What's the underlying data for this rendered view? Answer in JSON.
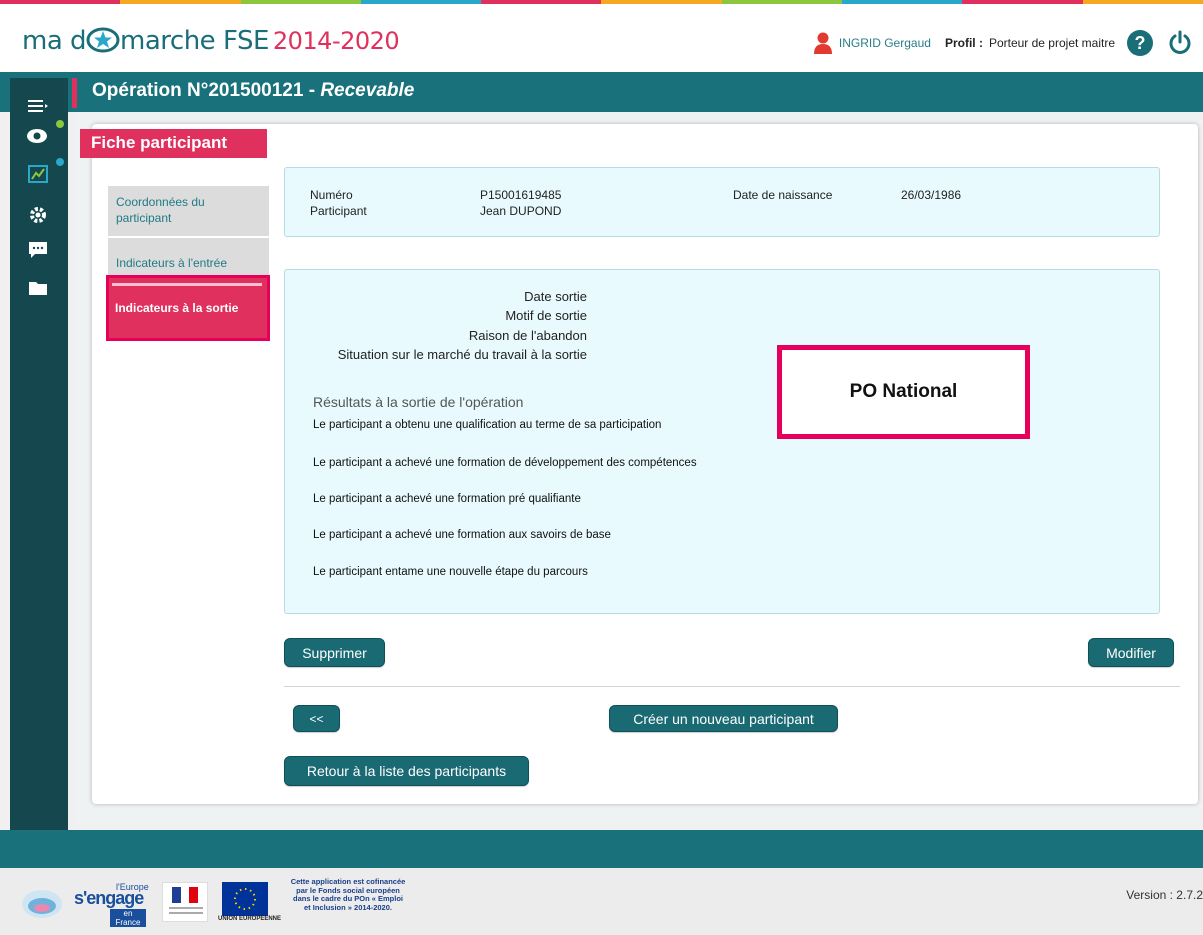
{
  "header": {
    "logo_prefix": "ma d",
    "logo_suffix": "marche FSE",
    "logo_years": "2014-2020",
    "user_name": "INGRID Gergaud",
    "profil_label": "Profil :",
    "profil_value": "Porteur de projet maitre"
  },
  "titlebar": {
    "operation": "Opération N°201500121 - ",
    "status": "Recevable"
  },
  "sidebar": {
    "icons": [
      "menu-icon",
      "eye-icon",
      "chart-icon",
      "gear-icon",
      "chat-icon",
      "folder-icon"
    ],
    "dot_colors": [
      "#8cc63f",
      "#29a8c9"
    ]
  },
  "fiche": {
    "tab_label": "Fiche participant",
    "subnav": {
      "coordonnees": "Coordonnées du participant",
      "indicateurs_entree": "Indicateurs à l'entrée",
      "indicateurs_sortie": "Indicateurs à la sortie"
    }
  },
  "info": {
    "numero_label": "Numéro",
    "numero_value": "P15001619485",
    "participant_label": "Participant",
    "participant_value": "Jean DUPOND",
    "naissance_label": "Date de naissance",
    "naissance_value": "26/03/1986"
  },
  "exit": {
    "date_sortie": "Date sortie",
    "motif_sortie": "Motif de sortie",
    "raison_abandon": "Raison de l'abandon",
    "situation": "Situation sur le marché du travail à la sortie",
    "results_title": "Résultats à la sortie de l'opération",
    "results": [
      "Le participant a obtenu une qualification au terme de sa participation",
      "Le participant a achevé une formation de développement des compétences",
      "Le participant a achevé une formation pré qualifiante",
      "Le participant a achevé une formation aux savoirs de base",
      "Le participant entame une nouvelle étape du parcours"
    ]
  },
  "annotation": "PO National",
  "buttons": {
    "supprimer": "Supprimer",
    "modifier": "Modifier",
    "prev": "<<",
    "creer": "Créer un nouveau participant",
    "retour": "Retour à la liste des participants"
  },
  "footer": {
    "cofinance": "Cette application est cofinancée par le Fonds social européen dans le cadre du POn « Emploi et Inclusion » 2014-2020.",
    "ue_label": "UNION EUROPÉENNE",
    "europe_label": "l'Europe",
    "engage_label": "s'engage",
    "en_france": "en France",
    "version": "Version : 2.7.2"
  },
  "colors": {
    "teal": "#19727b",
    "sidebar": "#15474f",
    "pink": "#e0305e",
    "stripe": [
      "#e0305e",
      "#f7a823",
      "#8cc63f",
      "#29a8c9",
      "#e0305e",
      "#f7a823",
      "#8cc63f",
      "#29a8c9",
      "#e0305e",
      "#f7a823"
    ]
  }
}
